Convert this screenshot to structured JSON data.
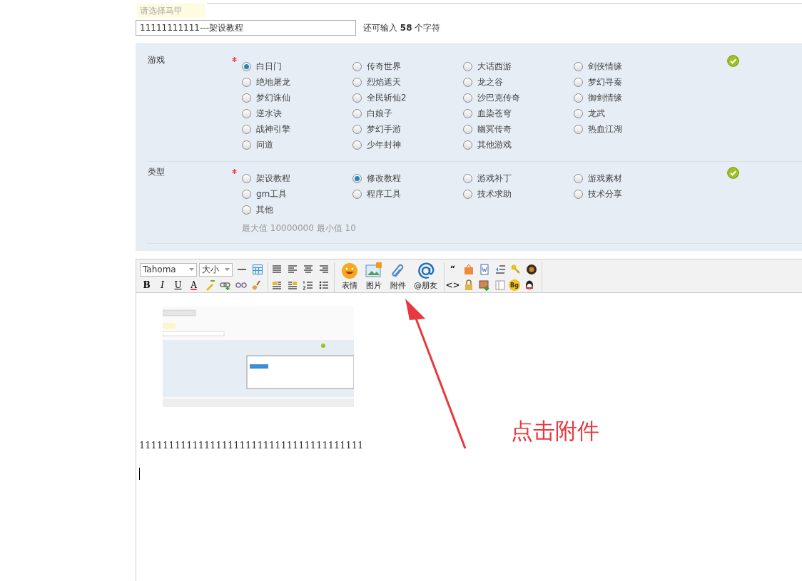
{
  "account": {
    "placeholder": "请选择马甲"
  },
  "title_field": {
    "value": "11111111111---架设教程",
    "counter": "还可输入 **58** 个字符"
  },
  "sections": [
    {
      "label": "游戏",
      "required": true,
      "valid": true,
      "options": [
        {
          "label": "白日门",
          "selected": true
        },
        {
          "label": "传奇世界",
          "selected": false
        },
        {
          "label": "大话西游",
          "selected": false
        },
        {
          "label": "剑侠情缘",
          "selected": false
        },
        {
          "label": "绝地屠龙",
          "selected": false
        },
        {
          "label": "烈焰遮天",
          "selected": false
        },
        {
          "label": "龙之谷",
          "selected": false
        },
        {
          "label": "梦幻寻秦",
          "selected": false
        },
        {
          "label": "梦幻诛仙",
          "selected": false
        },
        {
          "label": "全民斩仙2",
          "selected": false
        },
        {
          "label": "沙巴克传奇",
          "selected": false
        },
        {
          "label": "御剑情缘",
          "selected": false
        },
        {
          "label": "逆水诀",
          "selected": false
        },
        {
          "label": "白娘子",
          "selected": false
        },
        {
          "label": "血染苍穹",
          "selected": false
        },
        {
          "label": "龙武",
          "selected": false
        },
        {
          "label": "战神引擎",
          "selected": false
        },
        {
          "label": "梦幻手游",
          "selected": false
        },
        {
          "label": "幽冥传奇",
          "selected": false
        },
        {
          "label": "热血江湖",
          "selected": false
        },
        {
          "label": "问道",
          "selected": false
        },
        {
          "label": "少年封神",
          "selected": false
        },
        {
          "label": "其他游戏",
          "selected": false
        }
      ]
    },
    {
      "label": "类型",
      "required": true,
      "valid": true,
      "hint": "最大值 10000000 最小值 10",
      "options": [
        {
          "label": "架设教程",
          "selected": false
        },
        {
          "label": "修改教程",
          "selected": true
        },
        {
          "label": "游戏补丁",
          "selected": false
        },
        {
          "label": "游戏素材",
          "selected": false
        },
        {
          "label": "gm工具",
          "selected": false
        },
        {
          "label": "程序工具",
          "selected": false
        },
        {
          "label": "技术求助",
          "selected": false
        },
        {
          "label": "技术分享",
          "selected": false
        },
        {
          "label": "其他",
          "selected": false
        }
      ]
    }
  ],
  "toolbar": {
    "font": "Tahoma",
    "size": "大小",
    "format_buttons": [
      "B",
      "I",
      "U",
      "A"
    ],
    "media_buttons": [
      "表情",
      "图片",
      "附件",
      "@朋友"
    ],
    "quote": "“",
    "code": "<>",
    "bg": "Bg"
  },
  "editor": {
    "text": "11111111111111111111111111111111111111"
  },
  "annotation": {
    "text": "点击附件"
  }
}
